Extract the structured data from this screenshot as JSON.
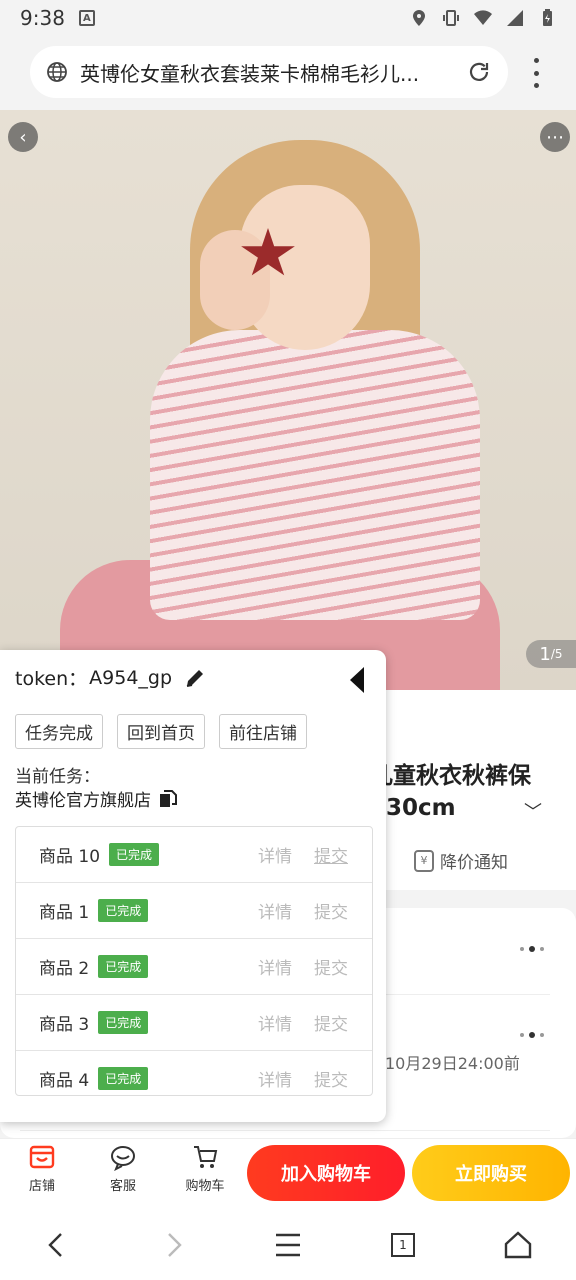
{
  "status_bar": {
    "time": "9:38",
    "a_badge": "A"
  },
  "url_bar": {
    "url_text": "英博伦女童秋衣套装莱卡棉棉毛衫儿..."
  },
  "hero": {
    "pager_current": "1",
    "pager_total": "/5"
  },
  "product": {
    "title_fragment_line1": "儿童秋衣秋裤保",
    "title_fragment_line2": "130cm",
    "price_alert": "降价通知",
    "price_alert_icon": "¥",
    "deadline": "10月29日24:00前"
  },
  "panel": {
    "token_label": "token：",
    "token_value": "A954_gp",
    "buttons": [
      "任务完成",
      "回到首页",
      "前往店铺"
    ],
    "current_task_label": "当前任务：",
    "current_store": "英博伦官方旗舰店",
    "items": [
      {
        "name": "商品 10",
        "status": "已完成",
        "detail": "详情",
        "submit": "提交"
      },
      {
        "name": "商品 1",
        "status": "已完成",
        "detail": "详情",
        "submit": "提交"
      },
      {
        "name": "商品 2",
        "status": "已完成",
        "detail": "详情",
        "submit": "提交"
      },
      {
        "name": "商品 3",
        "status": "已完成",
        "detail": "详情",
        "submit": "提交"
      },
      {
        "name": "商品 4",
        "status": "已完成",
        "detail": "详情",
        "submit": "提交"
      }
    ]
  },
  "action_bar": {
    "store": "店铺",
    "service": "客服",
    "cart": "购物车",
    "add_to_cart": "加入购物车",
    "buy_now": "立即购买"
  },
  "nav": {
    "tabs_count": "1"
  },
  "colors": {
    "accent_red": "#ff2a1f",
    "accent_yellow": "#ffc20e",
    "badge_green": "#4cae4c"
  }
}
